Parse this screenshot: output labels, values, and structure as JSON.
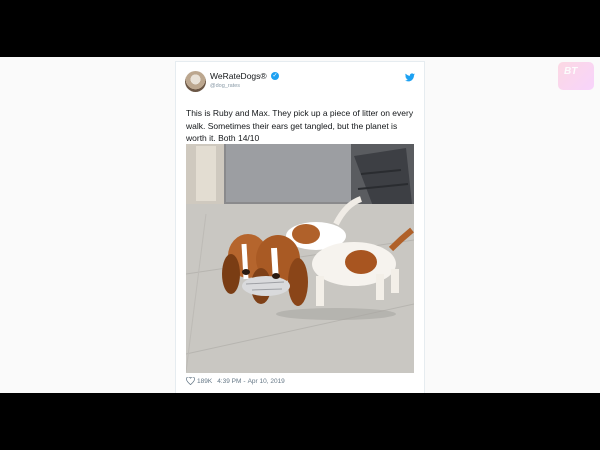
{
  "tweet": {
    "display_name": "WeRateDogs®",
    "handle": "@dog_rates",
    "text": "This is Ruby and Max. They pick up a piece of litter on every walk. Sometimes their ears get tangled, but the planet is worth it. Both 14/10",
    "likes": "189K",
    "time": "4:39 PM",
    "date": "Apr 10, 2019",
    "image_icon": "dogs-photo"
  },
  "icons": {
    "verified": "verified-badge-icon",
    "bird": "twitter-bird-icon",
    "heart": "heart-icon"
  },
  "watermark": {
    "text": "BT"
  },
  "colors": {
    "accent": "#1da1f2",
    "text": "#14171a",
    "muted": "#657786"
  }
}
